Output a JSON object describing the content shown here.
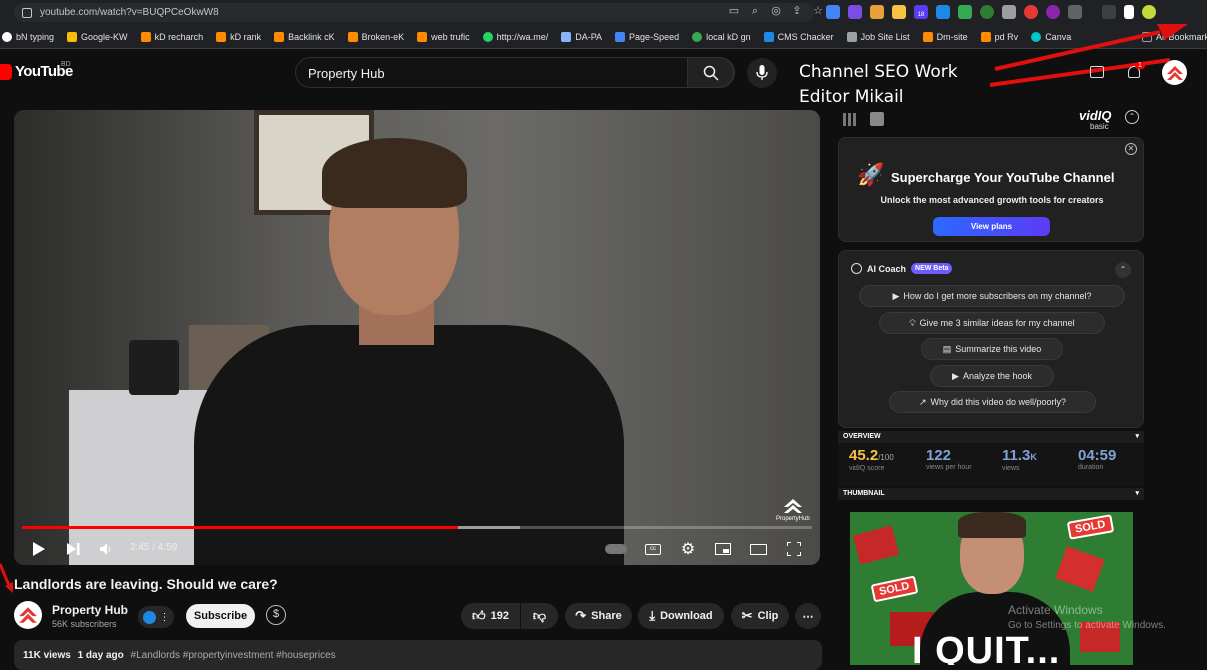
{
  "browser": {
    "url": "youtube.com/watch?v=BUQPCeOkwW8",
    "bookmarks": [
      "bN typing",
      "Google-KW",
      "kD recharch",
      "kD rank",
      "Backlink cK",
      "Broken-eK",
      "web trufic",
      "http://wa.me/",
      "DA-PA",
      "Page-Speed",
      "local kD gn",
      "CMS Chacker",
      "Job Site List",
      "Dm-site",
      "pd Rv",
      "Canva"
    ],
    "all_bookmarks": "All Bookmarks",
    "extension_badge": "18"
  },
  "youtube": {
    "logo_text": "YouTube",
    "country": "BD",
    "search_value": "Property Hub",
    "notification_count": "1"
  },
  "overlay": {
    "line1": "Channel SEO Work",
    "line2": "Editor Mikail"
  },
  "player": {
    "time": "2:45 / 4:59",
    "progress_fraction": 0.552,
    "buffered_fraction": 0.63,
    "watermark": "PropertyHub"
  },
  "video": {
    "title": "Landlords are leaving. Should we care?",
    "channel_name": "Property Hub",
    "subscribers": "56K subscribers",
    "subscribe_label": "Subscribe",
    "likes": "192",
    "share_label": "Share",
    "download_label": "Download",
    "clip_label": "Clip",
    "views": "11K views",
    "age": "1 day ago",
    "tags": "#Landlords #propertyinvestment #houseprices"
  },
  "vidiq": {
    "logo": "vidIQ",
    "plan": "basic",
    "promo_title": "Supercharge Your YouTube Channel",
    "promo_subtitle": "Unlock the most advanced growth tools for creators",
    "promo_button": "View plans",
    "coach_title": "AI Coach",
    "coach_badge": "NEW Beta",
    "questions": [
      "How do I get more subscribers on my channel?",
      "Give me 3 similar ideas for my channel",
      "Summarize this video",
      "Analyze the hook",
      "Why did this video do well/poorly?"
    ],
    "overview_label": "OVERVIEW",
    "score_value": "45.2",
    "score_max": "/100",
    "score_label": "vidIQ score",
    "vph_value": "122",
    "vph_label": "views per hour",
    "views_value": "11.3",
    "views_suffix": "K",
    "views_label": "views",
    "duration_value": "04:59",
    "duration_label": "duration",
    "thumbnail_label": "THUMBNAIL",
    "thumb_text": "I QUIT...",
    "sold_text": "SOLD"
  },
  "windows_watermark": {
    "line1": "Activate Windows",
    "line2": "Go to Settings to activate Windows."
  },
  "colors": {
    "yt_red": "#ff0000",
    "background": "#0f0f0f",
    "score_yellow": "#f6c344",
    "stat_blue": "#7fa3d6",
    "vidiq_purple": "#6d5dfc"
  }
}
